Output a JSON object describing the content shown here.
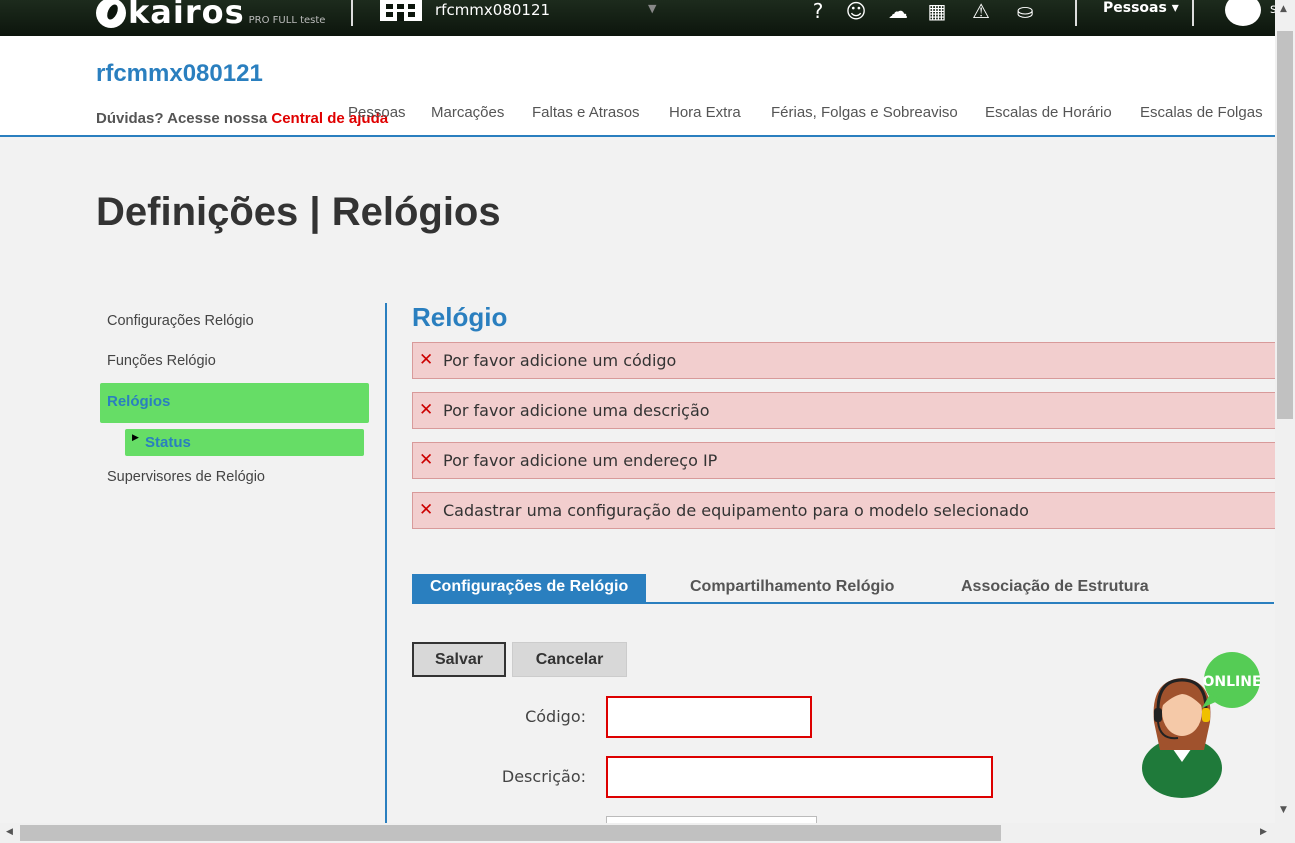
{
  "topbar": {
    "logo_text": "kairos",
    "logo_sub": "PRO FULL teste",
    "company": "rfcmmx080121",
    "company_caret": "▼",
    "icons": [
      "help-icon",
      "chat-support-icon",
      "cloud-download-icon",
      "calculator-icon",
      "warning-icon",
      "inbox-icon"
    ],
    "icon_glyphs": [
      "?",
      "☺",
      "☁",
      "▦",
      "⚠",
      "⛀"
    ],
    "pessoas": "Pessoas",
    "user_initial": "s"
  },
  "header": {
    "company": "rfcmmx080121",
    "help_prefix": "Dúvidas? Acesse nossa",
    "help_link": "Central de ajuda",
    "nav": [
      "Pessoas",
      "Marcações",
      "Faltas e Atrasos",
      "Hora Extra",
      "Férias, Folgas e Sobreaviso",
      "Escalas de Horário",
      "Escalas de Folgas"
    ]
  },
  "page_title": "Definições | Relógios",
  "sidebar": {
    "items": [
      "Configurações Relógio",
      "Funções Relógio",
      "Relógios",
      "Supervisores de Relógio"
    ],
    "sub_item": "Status"
  },
  "main": {
    "title": "Relógio",
    "errors": [
      "Por favor adicione um código",
      "Por favor adicione uma descrição",
      "Por favor adicione um endereço IP",
      "Cadastrar uma configuração de equipamento para o modelo selecionado"
    ],
    "tabs": [
      "Configurações de Relógio",
      "Compartilhamento Relógio",
      "Associação de Estrutura"
    ],
    "buttons": {
      "save": "Salvar",
      "cancel": "Cancelar"
    },
    "fields": {
      "codigo_label": "Código:",
      "descricao_label": "Descrição:"
    }
  },
  "support": {
    "badge": "ONLINE"
  },
  "colors": {
    "accent": "#2a7fbf",
    "active_green": "#66dd66",
    "error_bg": "#f2cece",
    "error_red": "#cc0000"
  }
}
